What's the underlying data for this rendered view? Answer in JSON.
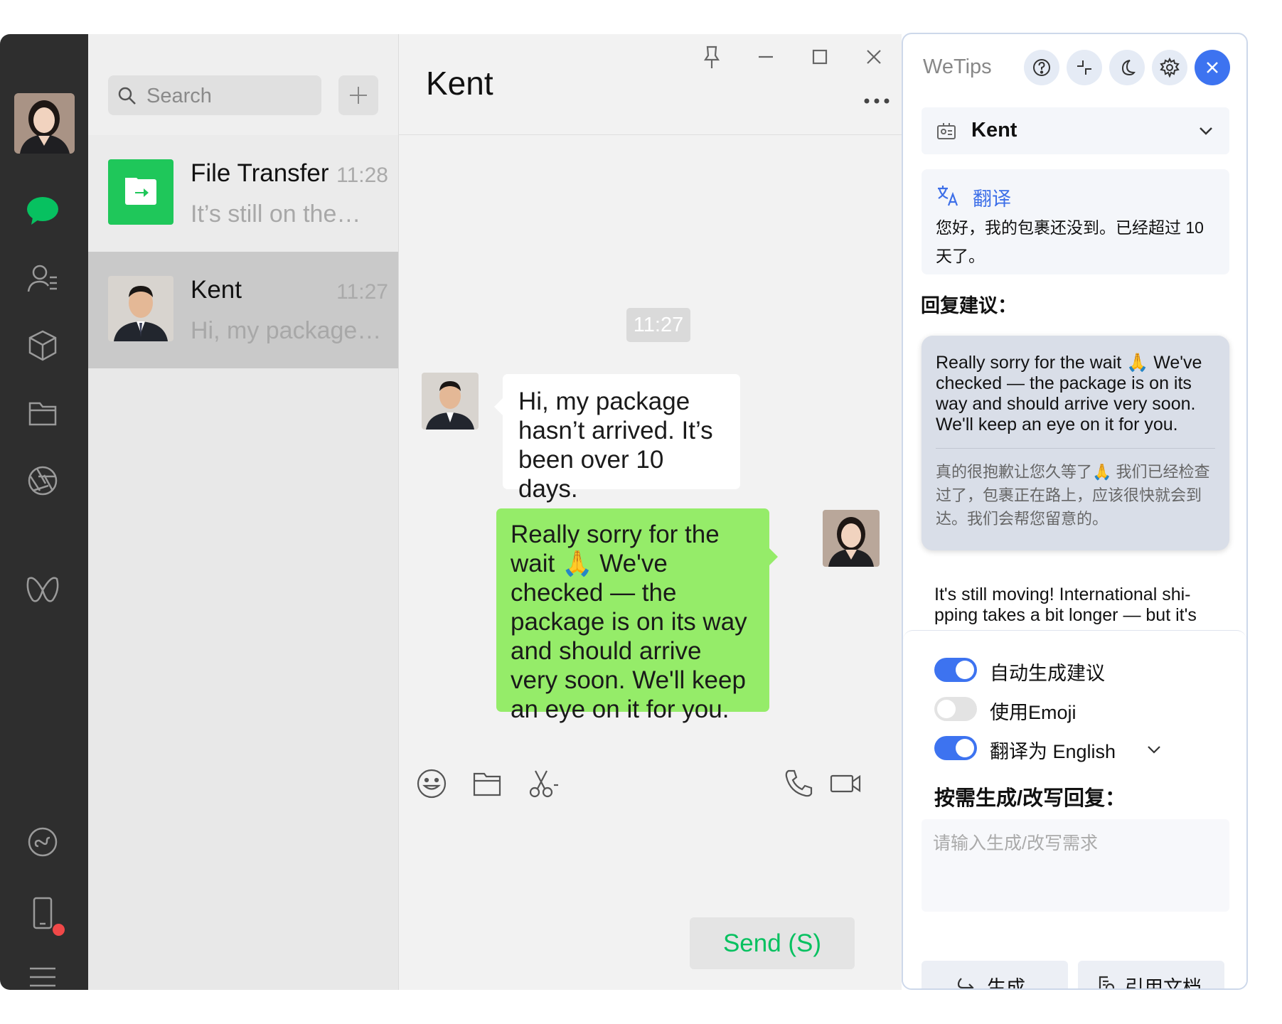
{
  "sidebar": {
    "items": [
      {
        "name": "chats",
        "icon": "chat-bubble-icon"
      },
      {
        "name": "contacts",
        "icon": "contacts-icon"
      },
      {
        "name": "favorites",
        "icon": "cube-icon"
      },
      {
        "name": "files",
        "icon": "folder-icon"
      },
      {
        "name": "moments",
        "icon": "aperture-icon"
      },
      {
        "name": "channels",
        "icon": "butterfly-icon"
      },
      {
        "name": "mini-programs",
        "icon": "mini-program-icon"
      },
      {
        "name": "phone",
        "icon": "phone-device-icon"
      },
      {
        "name": "menu",
        "icon": "menu-icon"
      }
    ],
    "accent": "#07c160"
  },
  "list": {
    "search_placeholder": "Search",
    "conversations": [
      {
        "name": "File Transfer",
        "time": "11:28",
        "preview": "It’s still on the…"
      },
      {
        "name": "Kent",
        "time": "11:27",
        "preview": "Hi, my package…"
      }
    ]
  },
  "chat": {
    "title": "Kent",
    "timestamp": "11:27",
    "incoming": "Hi, my package hasn’t arrived. It’s been over 10 days.",
    "outgoing": "Really sorry for the wait 🙏 We've checked — the package is on its way and should arrive very soon. We'll keep an eye on it for you.",
    "send_label": "Send (S)"
  },
  "tips": {
    "title": "WeTips",
    "contact": "Kent",
    "translate_label": "翻译",
    "translation": "您好，我的包裹还没到。已经超过 10 天了。",
    "suggest_title": "回复建议：",
    "suggestion_1_en": "Really sorry for the wait 🙏 We've checked — the package is on its way and should arrive very soon. We'll keep an eye on it for you.",
    "suggestion_1_zh": "真的很抱歉让您久等了🙏 我们已经检查过了，包裹正在路上，应该很快就会到达。我们会帮您留意的。",
    "suggestion_2_en": "It's still moving! International shi-pping takes a bit longer — but it's almost there…",
    "toggle_auto": "自动生成建议",
    "toggle_auto_on": true,
    "toggle_emoji": "使用Emoji",
    "toggle_emoji_on": false,
    "toggle_translate": "翻译为 English",
    "toggle_translate_on": true,
    "gen_title": "按需生成/改写回复：",
    "gen_placeholder": "请输入生成/改写需求",
    "btn_generate": "生成",
    "btn_reference": "引用文档",
    "accent": "#3d73f0"
  }
}
